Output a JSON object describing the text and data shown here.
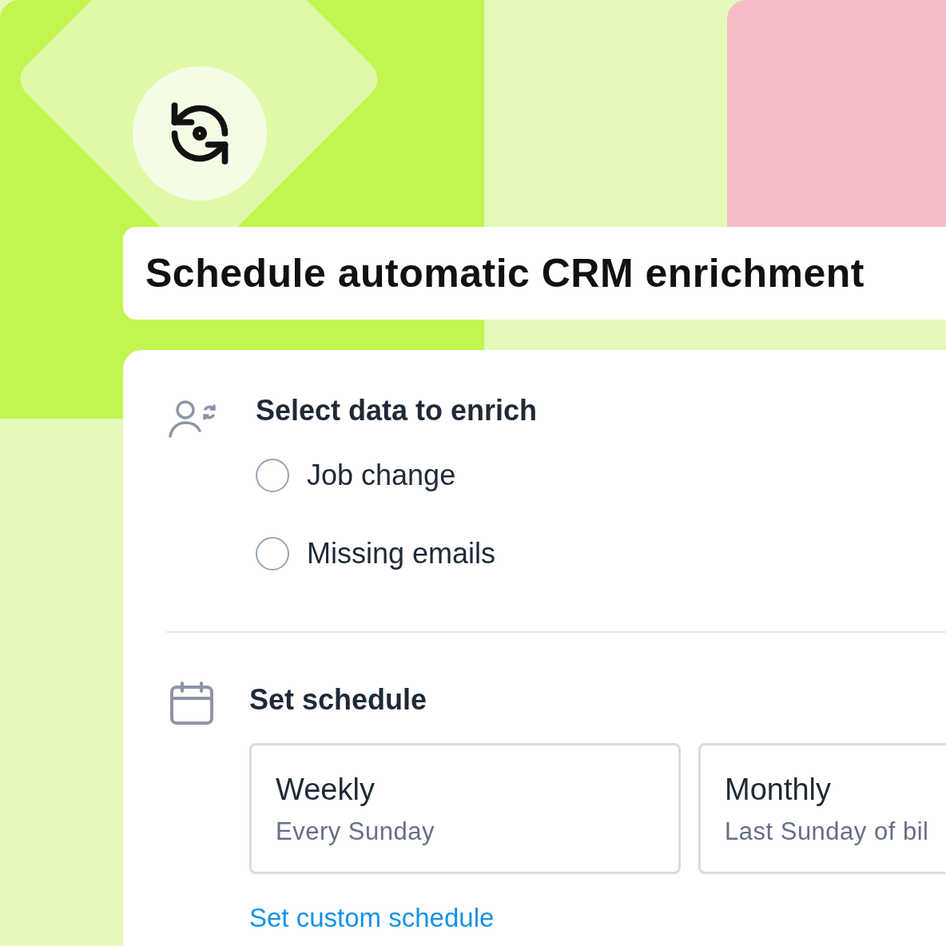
{
  "title": "Schedule automatic CRM enrichment",
  "data_section": {
    "heading": "Select data to enrich",
    "options": [
      {
        "label": "Job change",
        "selected": false
      },
      {
        "label": "Missing emails",
        "selected": false
      }
    ]
  },
  "schedule_section": {
    "heading": "Set schedule",
    "plans": [
      {
        "name": "Weekly",
        "detail": "Every Sunday",
        "selected": false
      },
      {
        "name": "Monthly",
        "detail": "Last Sunday of bil",
        "selected": false
      }
    ],
    "link": "Set custom schedule"
  }
}
